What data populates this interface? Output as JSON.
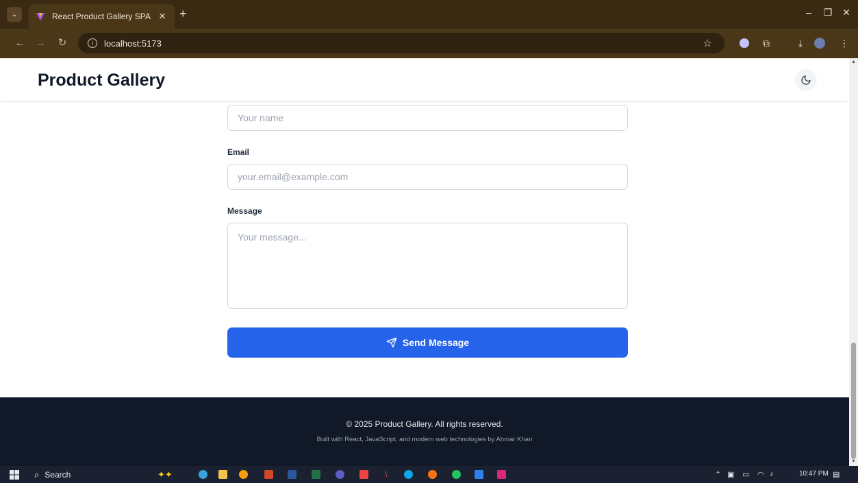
{
  "browser": {
    "tab_title": "React Product Gallery SPA",
    "url": "localhost:5173"
  },
  "header": {
    "brand": "Product Gallery"
  },
  "form": {
    "name_placeholder": "Your name",
    "email_label": "Email",
    "email_placeholder": "your.email@example.com",
    "message_label": "Message",
    "message_placeholder": "Your message...",
    "submit_label": "Send Message"
  },
  "footer": {
    "copyright": "© 2025 Product Gallery. All rights reserved.",
    "built_with": "Built with React, JavaScript, and modern web technologies by Ahmar Khan"
  },
  "taskbar": {
    "search_label": "Search",
    "clock": "10:47 PM"
  },
  "colors": {
    "primary": "#2563eb",
    "footer_bg": "#111827",
    "chrome_bg": "#3a2a12"
  }
}
